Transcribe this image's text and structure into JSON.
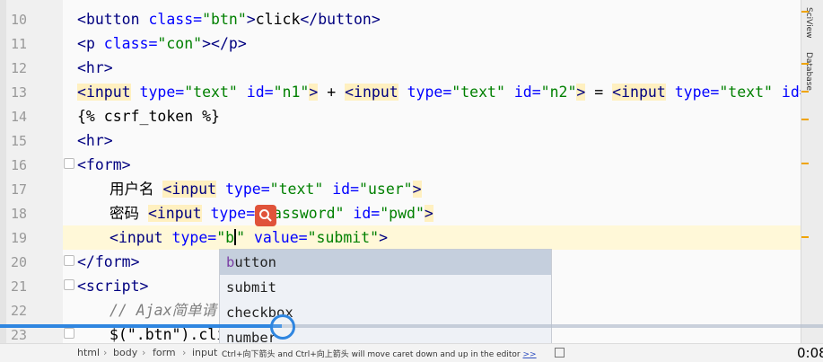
{
  "line_numbers": [
    "10",
    "11",
    "12",
    "13",
    "14",
    "15",
    "16",
    "17",
    "18",
    "19",
    "20",
    "21",
    "22",
    "23"
  ],
  "code": {
    "l10": {
      "lt": "<",
      "tag": "button",
      "attr": " class=",
      "val": "\"btn\"",
      "gt": ">",
      "text": "click",
      "close": "</",
      "tag2": "button",
      "gt2": ">"
    },
    "l11": {
      "lt": "<",
      "tag": "p",
      "attr": " class=",
      "val": "\"con\"",
      "gt": ">",
      "close": "</",
      "tag2": "p",
      "gt2": ">"
    },
    "l12": {
      "text": "<hr>"
    },
    "l13": {
      "p1": "<",
      "in1": "input",
      "a1": " type=",
      "v1": "\"text\"",
      "a2": " id=",
      "v2": "\"n1\"",
      "g1": ">",
      "plus": " + ",
      "p2": "<",
      "in2": "input",
      "a3": " type=",
      "v3": "\"text\"",
      "a4": " id=",
      "v4": "\"n2\"",
      "g2": ">",
      "eq": " = ",
      "p3": "<",
      "in3": "input",
      "a5": " type=",
      "v5": "\"text\"",
      "a6": " id="
    },
    "l14": {
      "text": "{% csrf_token %}"
    },
    "l15": {
      "text": "<hr>"
    },
    "l16": {
      "text": "<form>"
    },
    "l17": {
      "label": "用户名 ",
      "lt": "<",
      "tag": "input",
      "attr": " type=",
      "val": "\"text\"",
      "attr2": " id=",
      "val2": "\"user\"",
      "gt": ">"
    },
    "l18": {
      "label": "密码 ",
      "lt": "<",
      "tag": "input",
      "attr": " type=",
      "val": "\"password\"",
      "attr2": " id=",
      "val2": "\"pwd\"",
      "gt": ">"
    },
    "l19": {
      "lt": "<",
      "tag": "input",
      "attr": " type=",
      "val_open": "\"b",
      "val_close": "\"",
      "attr2": " value=",
      "val2": "\"submit\"",
      "gt": ">"
    },
    "l20": {
      "text": "</form>"
    },
    "l21": {
      "text": "<script>"
    },
    "l22": {
      "text": "// Ajax简单请"
    },
    "l23": {
      "text": "$(\".btn\").cli"
    }
  },
  "autocomplete": {
    "typed": "b",
    "items": [
      {
        "prefix": "b",
        "rest": "utton"
      },
      {
        "prefix": "sub",
        "rest": "mit"
      },
      {
        "prefix": "check",
        "rest": "box"
      },
      {
        "prefix": "num",
        "rest": "ber"
      }
    ]
  },
  "statusbar": {
    "crumbs": [
      "html",
      "body",
      "form",
      "input"
    ],
    "hint_text": "Ctrl+向下箭头 and Ctrl+向上箭头 will move caret down and up in the editor",
    "hint_link": ">>"
  },
  "side_tabs": [
    "SciView",
    "Database"
  ],
  "video": {
    "time": "0:08",
    "progress": 0.34
  },
  "colors": {
    "tag": "#000080",
    "attr": "#0000ff",
    "string": "#008000",
    "progress": "#2f86e0",
    "badge": "#e0533a"
  }
}
